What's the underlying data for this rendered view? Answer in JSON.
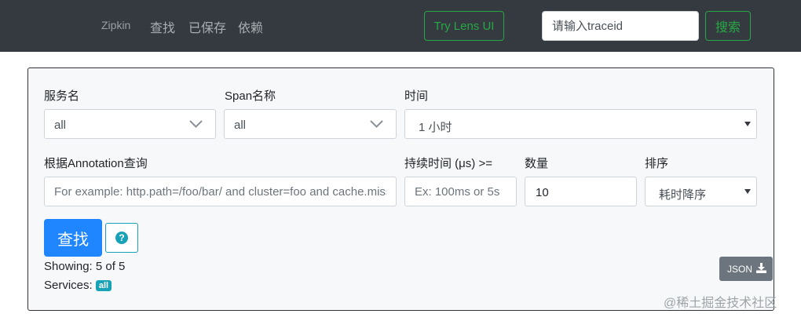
{
  "nav": {
    "brand": "Zipkin",
    "find": "查找",
    "saved": "已保存",
    "dependencies": "依赖",
    "lens_button": "Try Lens UI",
    "traceid_placeholder": "请输入traceid",
    "search_button": "搜索"
  },
  "form": {
    "service_label": "服务名",
    "service_value": "all",
    "span_label": "Span名称",
    "span_value": "all",
    "time_label": "时间",
    "time_value": "1 小时",
    "annotation_label": "根据Annotation查询",
    "annotation_placeholder": "For example: http.path=/foo/bar/ and cluster=foo and cache.miss",
    "duration_label": "持续时间 (μs) >=",
    "duration_placeholder": "Ex: 100ms or 5s",
    "limit_label": "数量",
    "limit_value": "10",
    "sort_label": "排序",
    "sort_value": "耗时降序",
    "find_button": "查找",
    "help_icon": "question-circle-icon"
  },
  "results": {
    "showing": "Showing: 5 of 5",
    "services_label": "Services:",
    "services_badge": "all",
    "json_button": "JSON",
    "download_icon": "download-icon"
  },
  "watermark": "@稀土掘金技术社区",
  "colors": {
    "navbar": "#343a40",
    "success": "#28a745",
    "primary": "#1f86ff",
    "info": "#17a2b8",
    "secondary": "#6c757d"
  }
}
